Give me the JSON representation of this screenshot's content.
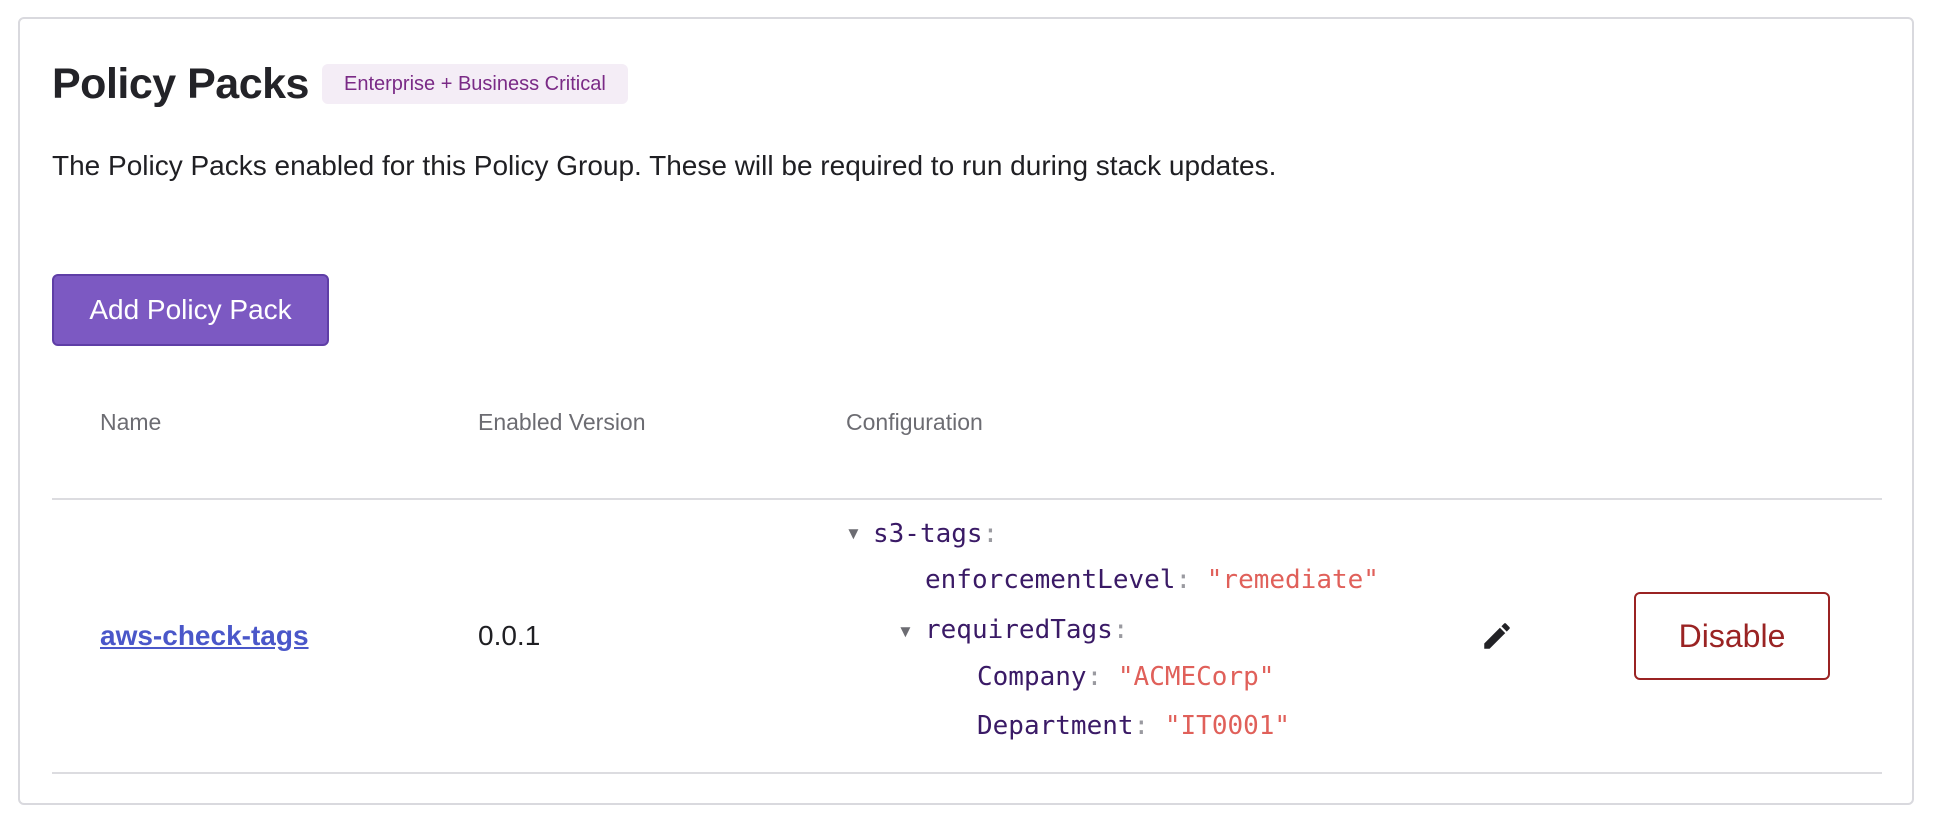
{
  "header": {
    "title": "Policy Packs",
    "tier_badge": "Enterprise + Business Critical",
    "description": "The Policy Packs enabled for this Policy Group. These will be required to run during stack updates."
  },
  "actions": {
    "add_label": "Add Policy Pack"
  },
  "table": {
    "columns": [
      "Name",
      "Enabled Version",
      "Configuration"
    ],
    "rows": [
      {
        "name": "aws-check-tags",
        "version": "0.0.1",
        "config": {
          "root_key": "s3-tags",
          "enforcement_key": "enforcementLevel",
          "enforcement_value": "\"remediate\"",
          "tags_key": "requiredTags",
          "tags": [
            {
              "key": "Company",
              "value": "\"ACMECorp\""
            },
            {
              "key": "Department",
              "value": "\"IT0001\""
            }
          ]
        },
        "disable_label": "Disable"
      }
    ]
  },
  "colors": {
    "primary": "#7c59c2",
    "link": "#4a57c9",
    "danger": "#9a2323",
    "badge_bg": "#f4edf6",
    "badge_text": "#7a2a86",
    "json_key": "#3a1a66",
    "json_string": "#e0605a"
  },
  "icons": {
    "collapse": "triangle-down-icon",
    "edit": "pencil-icon"
  }
}
